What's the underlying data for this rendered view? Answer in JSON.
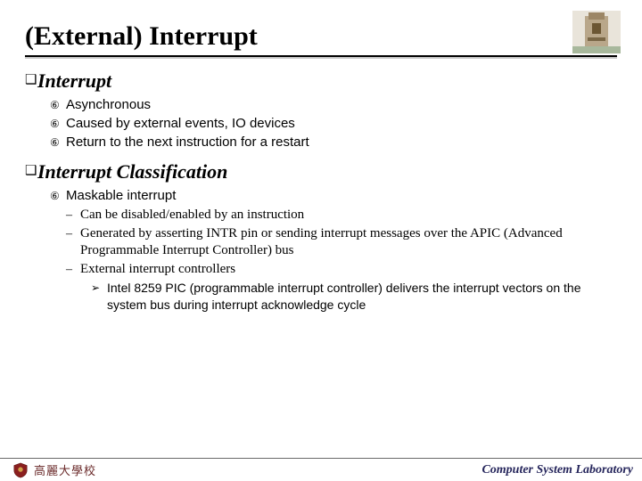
{
  "title": "(External) Interrupt",
  "sections": [
    {
      "heading": "Interrupt",
      "items": [
        "Asynchronous",
        "Caused by external events, IO devices",
        "Return to the next instruction for a restart"
      ]
    },
    {
      "heading": "Interrupt Classification",
      "items_complex": {
        "label": "Maskable interrupt",
        "subs": [
          "Can be disabled/enabled by an instruction",
          "Generated by asserting INTR pin or sending interrupt messages over the APIC (Advanced Programmable Interrupt Controller) bus",
          "External interrupt controllers"
        ],
        "subsub": "Intel 8259 PIC (programmable interrupt controller) delivers the interrupt vectors on the system bus during interrupt acknowledge cycle"
      }
    }
  ],
  "footer": {
    "left": "高麗大學校",
    "right": "Computer System Laboratory"
  }
}
